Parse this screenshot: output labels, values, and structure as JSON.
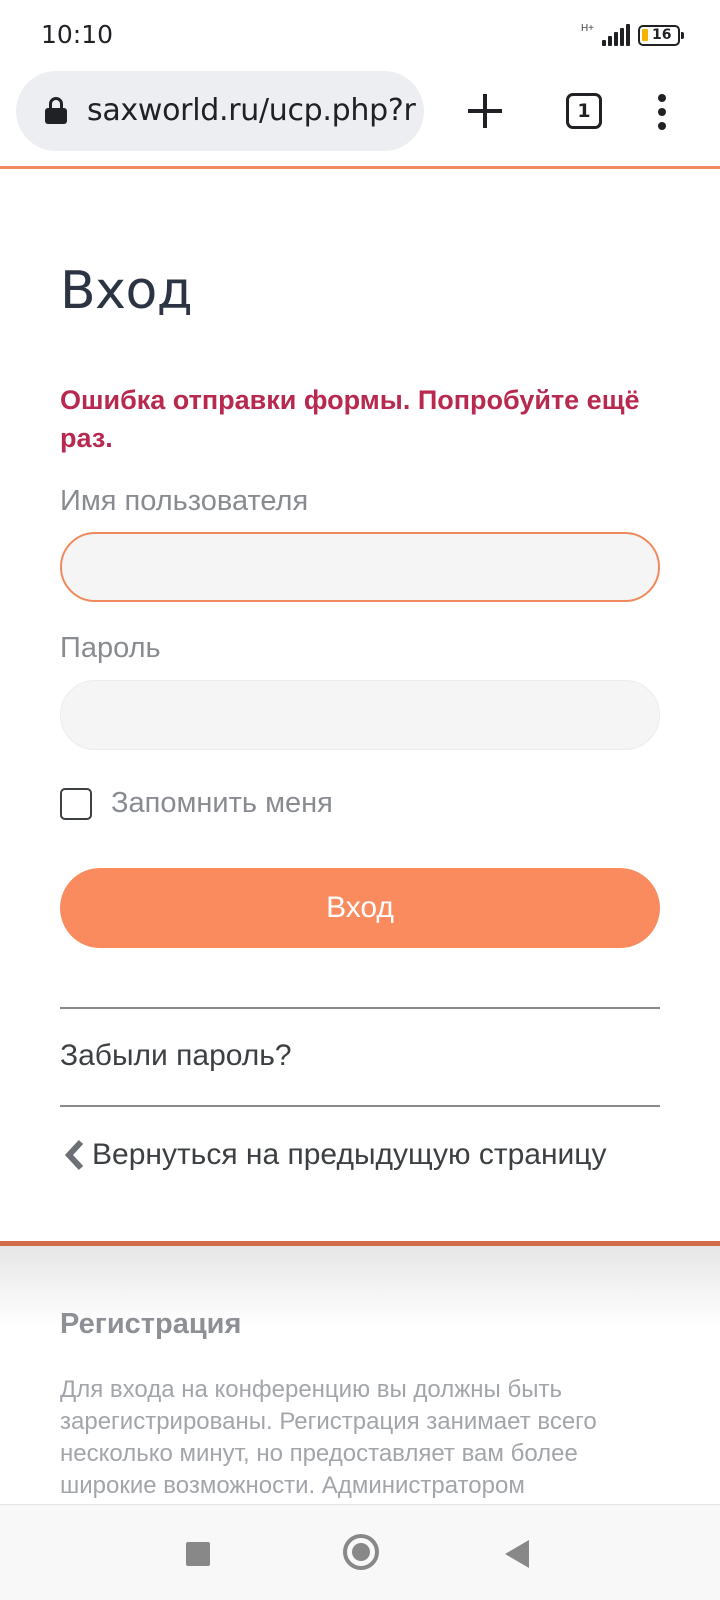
{
  "status_bar": {
    "time": "10:10",
    "network_type": "H+",
    "battery_level": "16",
    "signal_bars": 5
  },
  "browser": {
    "url": "saxworld.ru/ucp.php?r",
    "tab_count": "1",
    "icons": [
      "lock-icon",
      "plus-icon",
      "tab-switcher-icon",
      "more-vert-icon"
    ]
  },
  "login": {
    "title": "Вход",
    "error": "Ошибка отправки формы. Попробуйте ещё раз.",
    "username_label": "Имя пользователя",
    "username_value": "",
    "password_label": "Пароль",
    "password_value": "",
    "remember_label": "Запомнить меня",
    "remember_checked": false,
    "submit_label": "Вход",
    "forgot_link": "Забыли пароль?",
    "back_link": "Вернуться на предыдущую страницу"
  },
  "registration": {
    "title": "Регистрация",
    "text": "Для входа на конференцию вы должны быть зарегистрированы. Регистрация занимает всего несколько минут, но предоставляет вам более широкие возможности. Администратором"
  },
  "colors": {
    "accent": "#f98b5e",
    "error": "#b8294f",
    "title": "#2c3443"
  },
  "nav_bar": {
    "icons": [
      "recents-square-icon",
      "home-circle-icon",
      "back-triangle-icon"
    ]
  }
}
